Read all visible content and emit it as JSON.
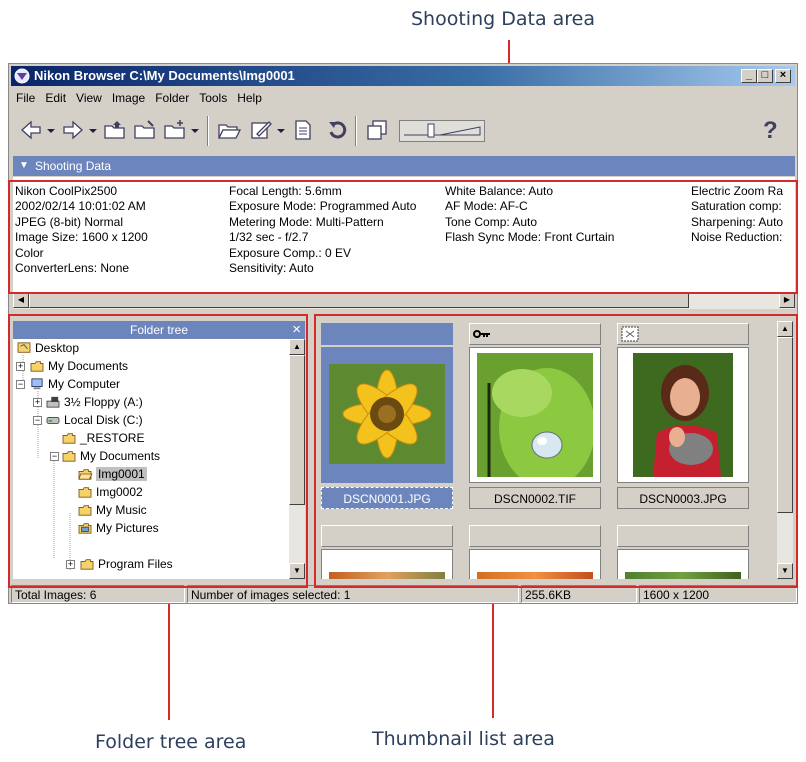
{
  "callouts": {
    "shooting": "Shooting Data area",
    "folder": "Folder tree area",
    "thumbnail": "Thumbnail list area"
  },
  "window": {
    "title": "Nikon Browser C:\\My Documents\\Img0001",
    "minimize": "_",
    "maximize": "□",
    "close": "×"
  },
  "menu": [
    "File",
    "Edit",
    "View",
    "Image",
    "Folder",
    "Tools",
    "Help"
  ],
  "toolbar": {
    "icons": [
      "back-arrow-icon",
      "forward-arrow-icon",
      "folder-up-icon",
      "folder-mark-icon",
      "new-folder-icon",
      "open-folder-icon",
      "edit-icon",
      "document-icon",
      "rotate-icon",
      "copy-icon",
      "thumbnail-size-slider",
      "help-icon"
    ],
    "help": "?"
  },
  "shooting_data": {
    "header": "Shooting Data",
    "columns": [
      [
        "Nikon CoolPix2500",
        "2002/02/14 10:01:02 AM",
        "JPEG (8-bit) Normal",
        "Image Size:  1600 x 1200",
        "Color",
        "ConverterLens: None"
      ],
      [
        "Focal Length: 5.6mm",
        "Exposure Mode: Programmed Auto",
        "Metering Mode: Multi-Pattern",
        "1/32 sec - f/2.7",
        "Exposure Comp.: 0 EV",
        "Sensitivity: Auto"
      ],
      [
        "White Balance: Auto",
        "AF Mode: AF-C",
        "Tone Comp: Auto",
        "Flash Sync Mode: Front Curtain"
      ],
      [
        "Electric Zoom Ra",
        "Saturation comp:",
        "Sharpening: Auto",
        "Noise Reduction:"
      ]
    ]
  },
  "folder_tree": {
    "header": "Folder tree",
    "close": "×",
    "nodes": [
      "Desktop",
      "My Documents",
      "My Computer",
      "3½ Floppy (A:)",
      "Local Disk (C:)",
      "_RESTORE",
      "My Documents",
      "Img0001",
      "Img0002",
      "My Music",
      "My Pictures",
      "Program Files"
    ]
  },
  "thumbnails": [
    {
      "name": "DSCN0001.JPG",
      "selected": true
    },
    {
      "name": "DSCN0002.TIF",
      "selected": false
    },
    {
      "name": "DSCN0003.JPG",
      "selected": false
    }
  ],
  "status": {
    "total": "Total Images: 6",
    "selected": "Number of images selected: 1",
    "size": "255.6KB",
    "dims": "1600 x 1200"
  },
  "colors": {
    "accent_red": "#d42a2a",
    "title_blue": "#0a246a",
    "panel_header": "#6c86bd",
    "selection": "#6c86bd"
  }
}
